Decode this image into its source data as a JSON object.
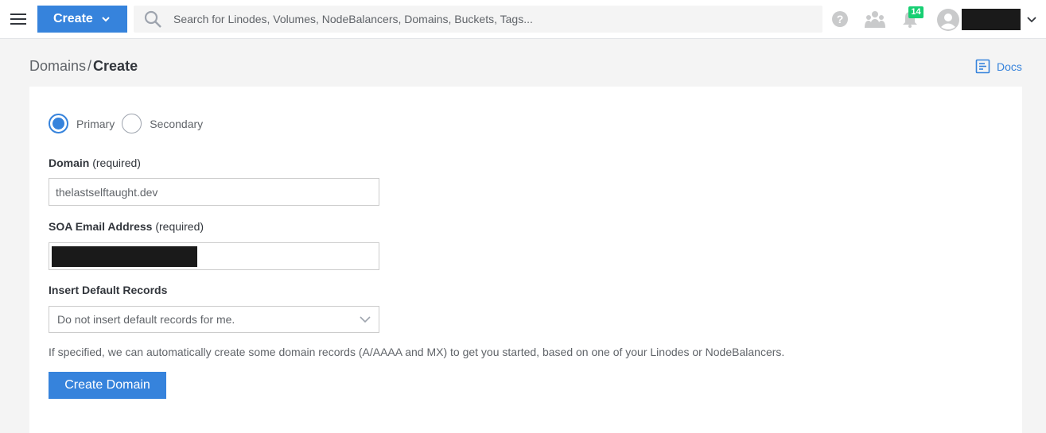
{
  "topbar": {
    "create_label": "Create",
    "search_placeholder": "Search for Linodes, Volumes, NodeBalancers, Domains, Buckets, Tags...",
    "notification_count": "14"
  },
  "header": {
    "breadcrumb_parent": "Domains",
    "breadcrumb_separator": "/",
    "breadcrumb_current": "Create",
    "docs_label": "Docs"
  },
  "form": {
    "type_options": [
      {
        "label": "Primary",
        "selected": true
      },
      {
        "label": "Secondary",
        "selected": false
      }
    ],
    "domain_label": "Domain",
    "domain_required": "(required)",
    "domain_value": "thelastselftaught.dev",
    "soa_label": "SOA Email Address",
    "soa_required": "(required)",
    "default_records_label": "Insert Default Records",
    "default_records_value": "Do not insert default records for me.",
    "helper_text": "If specified, we can automatically create some domain records (A/AAAA and MX) to get you started, based on one of your Linodes or NodeBalancers.",
    "submit_label": "Create Domain"
  },
  "colors": {
    "accent": "#3683dc",
    "badge": "#17cf73"
  }
}
